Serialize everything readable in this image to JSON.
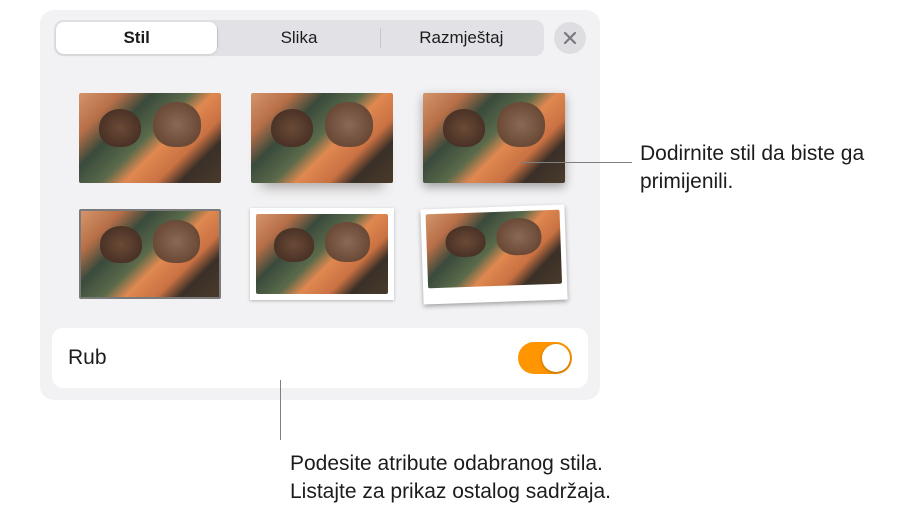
{
  "tabs": {
    "style": "Stil",
    "image": "Slika",
    "layout": "Razmještaj",
    "selected": "style"
  },
  "section": {
    "border_label": "Rub",
    "border_on": true
  },
  "callouts": {
    "tap_style": "Dodirnite stil da biste ga primijenili.",
    "adjust_attrs_line1": "Podesite atribute odabranog stila.",
    "adjust_attrs_line2": "Listajte za prikaz ostalog sadržaja."
  },
  "styles": [
    {
      "id": "plain"
    },
    {
      "id": "reflect"
    },
    {
      "id": "shadow"
    },
    {
      "id": "border"
    },
    {
      "id": "frame"
    },
    {
      "id": "polaroid"
    }
  ]
}
